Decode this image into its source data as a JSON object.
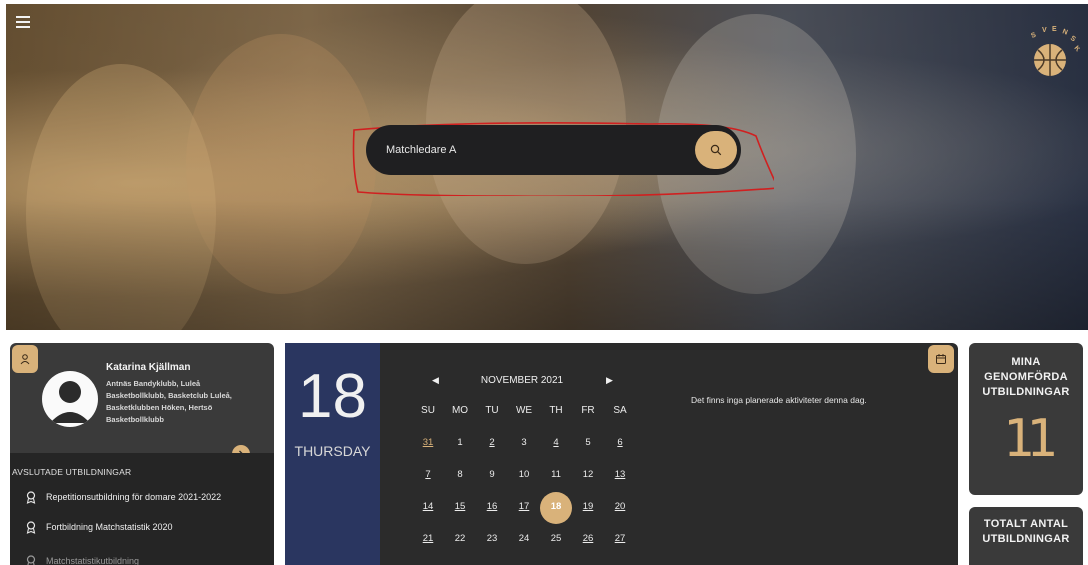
{
  "header": {
    "menu_icon": "hamburger-menu-icon",
    "logo_text": "SVENSK BASKET"
  },
  "search": {
    "value": "Matchledare A",
    "placeholder": "",
    "button_icon": "search-icon"
  },
  "profile": {
    "icon": "user-icon",
    "name": "Katarina Kjällman",
    "clubs": "Antnäs Bandyklubb, Luleå Basketbollklubb, Basketclub Luleå, Basketklubben Höken, Hertsö Basketbollklubb",
    "more_icon": "chevron-right-icon"
  },
  "completed": {
    "title": "AVSLUTADE UTBILDNINGAR",
    "items": [
      {
        "label": "Repetitionsutbildning för domare 2021-2022",
        "icon": "award-icon"
      },
      {
        "label": "Fortbildning Matchstatistik 2020",
        "icon": "award-icon"
      },
      {
        "label": "Matchstatistikutbildning",
        "icon": "award-icon"
      }
    ]
  },
  "date": {
    "day": "18",
    "weekday": "THURSDAY"
  },
  "calendar": {
    "month": "NOVEMBER 2021",
    "prev_icon": "triangle-left-icon",
    "next_icon": "triangle-right-icon",
    "headers": [
      "SU",
      "MO",
      "TU",
      "WE",
      "TH",
      "FR",
      "SA"
    ],
    "weeks": [
      [
        "31",
        "1",
        "2",
        "3",
        "4",
        "5",
        "6"
      ],
      [
        "7",
        "8",
        "9",
        "10",
        "11",
        "12",
        "13"
      ],
      [
        "14",
        "15",
        "16",
        "17",
        "18",
        "19",
        "20"
      ],
      [
        "21",
        "22",
        "23",
        "24",
        "25",
        "26",
        "27"
      ]
    ]
  },
  "activities": {
    "icon": "calendar-icon",
    "empty_text": "Det finns inga planerade aktiviteter denna dag."
  },
  "stats": {
    "completed_title": "MINA GENOMFÖRDA UTBILDNINGAR",
    "completed_value": "11",
    "total_title": "TOTALT ANTAL UTBILDNINGAR"
  },
  "colors": {
    "accent": "#d9b27a",
    "card_dark": "#2b2b2b",
    "date_blue": "#2a3660",
    "annotation": "#d02020"
  }
}
